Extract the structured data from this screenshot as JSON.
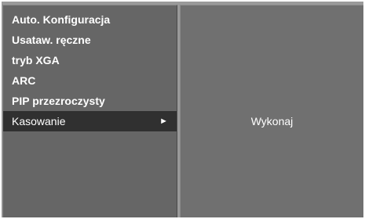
{
  "menu": {
    "items": [
      {
        "label": "Auto. Konfiguracja"
      },
      {
        "label": "Usataw. ręczne"
      },
      {
        "label": "tryb XGA"
      },
      {
        "label": "ARC"
      },
      {
        "label": "PIP przezroczysty"
      },
      {
        "label": "Kasowanie",
        "selected": true,
        "arrow": "►"
      }
    ]
  },
  "submenu": {
    "option_label": "Wykonaj"
  },
  "colors": {
    "panel": "#666666",
    "selected_row": "#303030",
    "submenu_panel": "#707070",
    "frame": "#9a9a9a",
    "text": "#ffffff"
  }
}
